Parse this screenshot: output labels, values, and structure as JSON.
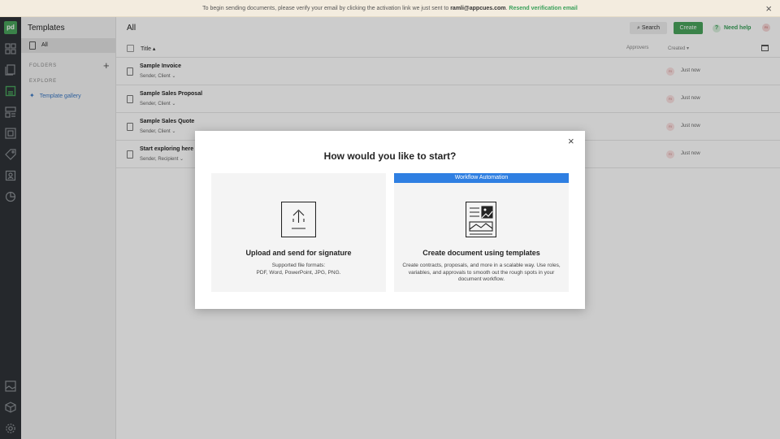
{
  "banner": {
    "text": "To begin sending documents, please verify your email by clicking the activation link we just sent to ",
    "email": "ramli@appcues.com",
    "period": ".",
    "resend_label": "Resend verification email",
    "close_icon": "×"
  },
  "rail": {
    "logo": "pd",
    "icons": [
      "dashboard-icon",
      "documents-icon",
      "templates-icon",
      "forms-icon",
      "catalog-icon",
      "tags-icon",
      "contacts-icon",
      "reports-icon",
      "media-icon",
      "integrations-icon",
      "settings-icon"
    ]
  },
  "sidebar": {
    "title": "Templates",
    "all_label": "All",
    "folders_label": "FOLDERS",
    "add_icon": "+",
    "explore_label": "EXPLORE",
    "gallery_label": "Template gallery"
  },
  "main": {
    "title": "All",
    "search_label": "Search",
    "create_label": "Create",
    "help_label": "Need help",
    "avatar_initials": "RI",
    "columns": {
      "title": "Title",
      "approvers": "Approvers",
      "created": "Created"
    },
    "rows": [
      {
        "name": "Sample Invoice",
        "roles": "Sender, Client",
        "avatar": "RI",
        "time": "Just now"
      },
      {
        "name": "Sample Sales Proposal",
        "roles": "Sender, Client",
        "avatar": "RI",
        "time": "Just now"
      },
      {
        "name": "Sample Sales Quote",
        "roles": "Sender, Client",
        "avatar": "RI",
        "time": "Just now"
      },
      {
        "name": "Start exploring here",
        "roles": "Sender, Recipient",
        "avatar": "RI",
        "time": "Just now"
      }
    ]
  },
  "modal": {
    "close_icon": "×",
    "heading": "How would you like to start?",
    "cards": [
      {
        "title": "Upload and send for signature",
        "desc_line1": "Supported file formats:",
        "desc_line2": "PDF, Word, PowerPoint, JPG, PNG."
      },
      {
        "tag": "Workflow Automation",
        "title": "Create document using templates",
        "desc": "Create contracts, proposals, and more in a scalable way. Use roles, variables, and approvals to smooth out the rough spots in your document workflow."
      }
    ]
  },
  "colors": {
    "brand_green": "#49a35c",
    "accent_blue": "#2f7fe2",
    "rail_bg": "#2f3337",
    "banner_bg": "#f3ecdf"
  }
}
